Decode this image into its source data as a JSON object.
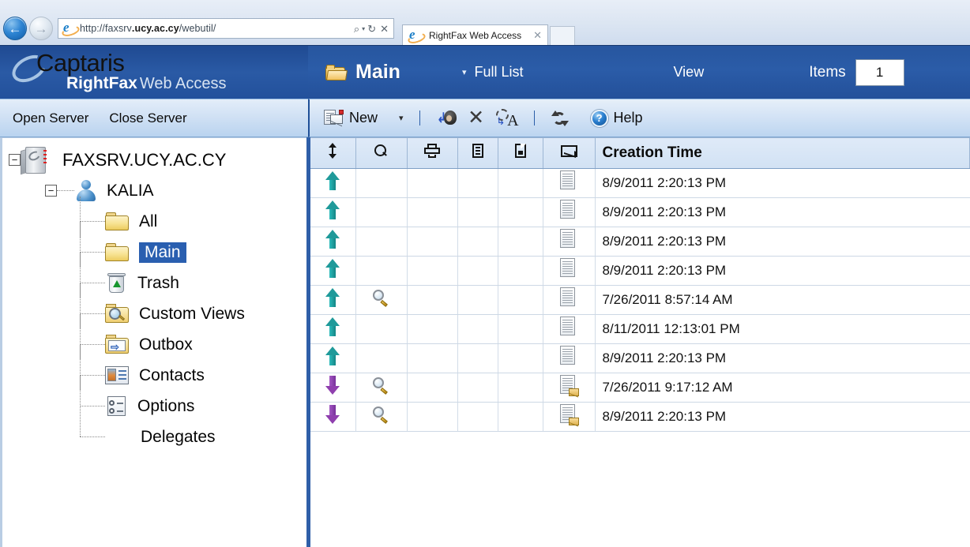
{
  "browser": {
    "back_icon": "back-arrow-icon",
    "forward_icon": "forward-arrow-icon",
    "url_prefix": "http://faxsrv",
    "url_bold": ".ucy.ac.cy",
    "url_suffix": "/webutil/",
    "url_full": "http://faxsrv.ucy.ac.cy/webutil/",
    "search_icon": "search-magnifier-icon",
    "search_caret": "▾",
    "refresh_icon": "↻",
    "stop_icon": "✕",
    "tab_title": "RightFax Web Access",
    "tab_close": "✕"
  },
  "header": {
    "brand_captaris": "Captaris",
    "brand_rightfax": "RightFax",
    "brand_webaccess": "Web Access",
    "folder_icon": "open-folder-icon",
    "current_folder": "Main",
    "caret": "▾",
    "full_list": "Full List",
    "view": "View",
    "items_label": "Items",
    "items_value": "1",
    "accent_blue": "#2b5ca8"
  },
  "menu": {
    "open_server": "Open Server",
    "close_server": "Close Server"
  },
  "toolbar": {
    "new_label": "New",
    "new_icon": "new-fax-icon",
    "new_caret": "▾",
    "forward_icon": "forward-to-person-icon",
    "delete_icon": "✕",
    "ocr_icon": "ocr-convert-icon",
    "refresh_icon": "refresh-icon",
    "help_icon": "help-circle-icon",
    "help_label": "Help",
    "separator": "|"
  },
  "sidebar": {
    "server": {
      "label": "FAXSRV.UCY.AC.CY",
      "expander": "−",
      "icon": "server-icon"
    },
    "user": {
      "label": "KALIA",
      "expander": "−",
      "icon": "user-icon"
    },
    "items": [
      {
        "label": "All",
        "icon": "folder-icon",
        "selected": false
      },
      {
        "label": "Main",
        "icon": "folder-icon",
        "selected": true
      },
      {
        "label": "Trash",
        "icon": "trash-icon",
        "selected": false
      },
      {
        "label": "Custom Views",
        "icon": "custom-views-icon",
        "selected": false
      },
      {
        "label": "Outbox",
        "icon": "outbox-icon",
        "selected": false
      },
      {
        "label": "Contacts",
        "icon": "contacts-icon",
        "selected": false
      },
      {
        "label": "Options",
        "icon": "options-icon",
        "selected": false
      },
      {
        "label": "Delegates",
        "icon": "delegates-icon",
        "selected": false
      }
    ]
  },
  "table": {
    "columns": [
      {
        "icon": "sort-updown-icon",
        "label": ""
      },
      {
        "icon": "magnifier-icon",
        "label": ""
      },
      {
        "icon": "printer-icon",
        "label": ""
      },
      {
        "icon": "document-icon",
        "label": ""
      },
      {
        "icon": "page-fold-icon",
        "label": ""
      },
      {
        "icon": "envelope-icon",
        "label": ""
      },
      {
        "icon": "",
        "label": "Creation Time"
      }
    ],
    "rows": [
      {
        "direction": "up",
        "viewed": false,
        "attachment": "document",
        "creation_time": "8/9/2011 2:20:13 PM"
      },
      {
        "direction": "up",
        "viewed": false,
        "attachment": "document",
        "creation_time": "8/9/2011 2:20:13 PM"
      },
      {
        "direction": "up",
        "viewed": false,
        "attachment": "document",
        "creation_time": "8/9/2011 2:20:13 PM"
      },
      {
        "direction": "up",
        "viewed": false,
        "attachment": "document",
        "creation_time": "8/9/2011 2:20:13 PM"
      },
      {
        "direction": "up",
        "viewed": true,
        "attachment": "document",
        "creation_time": "7/26/2011 8:57:14 AM"
      },
      {
        "direction": "up",
        "viewed": false,
        "attachment": "document",
        "creation_time": "8/11/2011 12:13:01 PM"
      },
      {
        "direction": "up",
        "viewed": false,
        "attachment": "document",
        "creation_time": "8/9/2011 2:20:13 PM"
      },
      {
        "direction": "down",
        "viewed": true,
        "attachment": "document-envelope",
        "creation_time": "7/26/2011 9:17:12 AM"
      },
      {
        "direction": "down",
        "viewed": true,
        "attachment": "document-envelope",
        "creation_time": "8/9/2011 2:20:13 PM"
      }
    ]
  }
}
